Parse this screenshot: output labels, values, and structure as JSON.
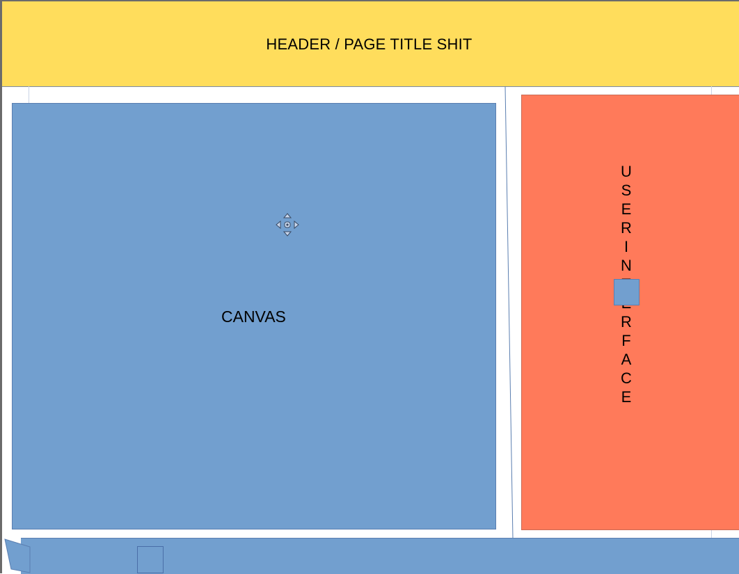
{
  "header": {
    "title": "HEADER / PAGE TITLE SHIT"
  },
  "canvas": {
    "label": "CANVAS"
  },
  "ui_panel": {
    "label": "USERINTERFACE",
    "letters": [
      "U",
      "S",
      "E",
      "R",
      "I",
      "N",
      "T",
      "E",
      "R",
      "F",
      "A",
      "C",
      "E"
    ]
  },
  "colors": {
    "header": "#ffdd5c",
    "canvas": "#729fcf",
    "ui_panel": "#ff7a5a",
    "bottom_bar": "#729fcf"
  },
  "icons": {
    "move_handle": "move-arrows-icon"
  }
}
